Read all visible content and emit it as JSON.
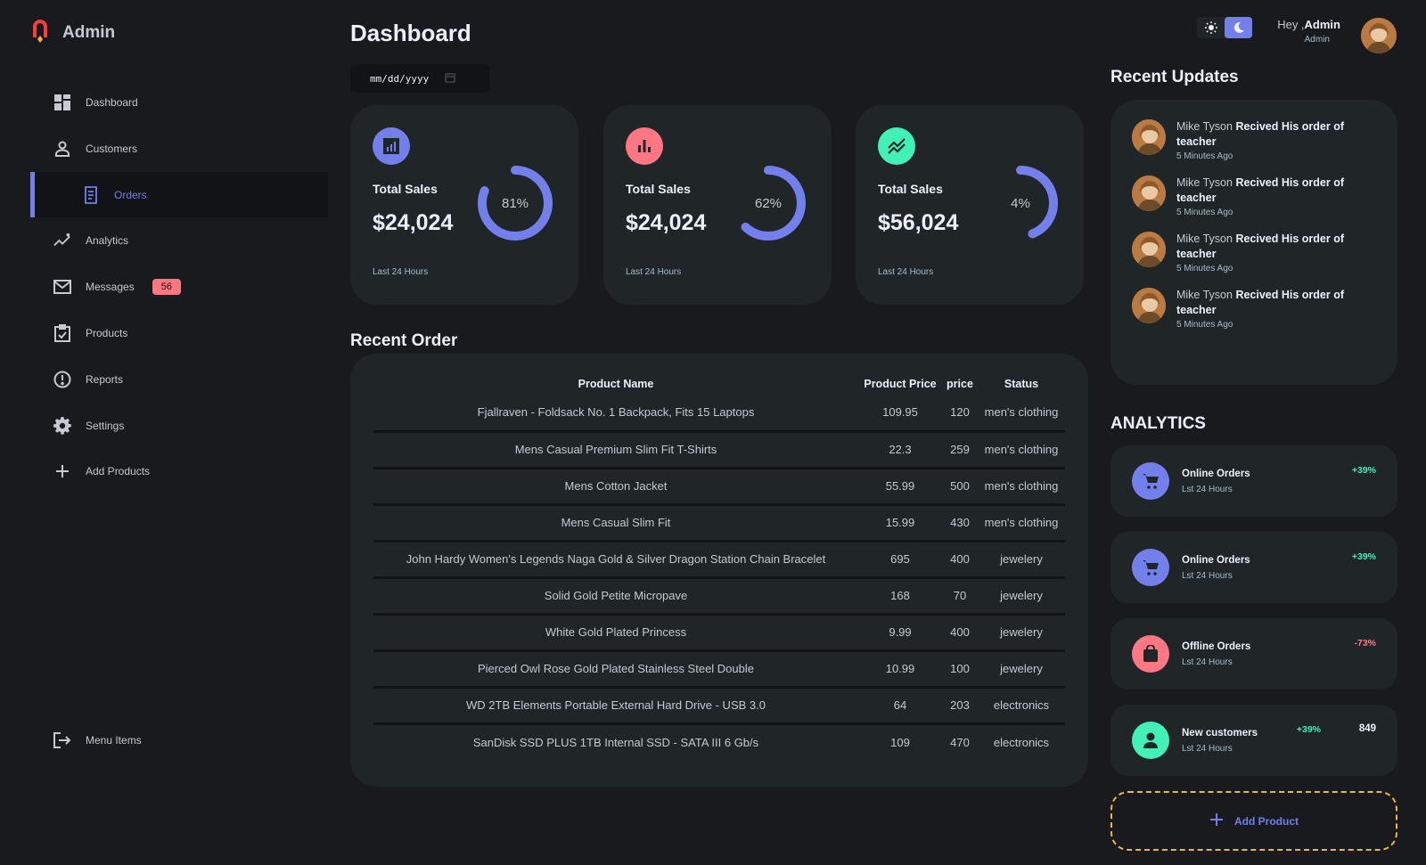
{
  "brand": {
    "title": "Admin"
  },
  "sidebar": {
    "items": [
      {
        "label": "Dashboard",
        "icon": "grid-icon"
      },
      {
        "label": "Customers",
        "icon": "person-icon"
      },
      {
        "label": "Orders",
        "icon": "receipt-icon",
        "active": true
      },
      {
        "label": "Analytics",
        "icon": "insights-icon"
      },
      {
        "label": "Messages",
        "icon": "mail-icon",
        "badge": "56"
      },
      {
        "label": "Products",
        "icon": "inventory-icon"
      },
      {
        "label": "Reports",
        "icon": "report-icon"
      },
      {
        "label": "Settings",
        "icon": "gear-icon"
      },
      {
        "label": "Add Products",
        "icon": "plus-icon"
      }
    ],
    "logout": {
      "label": "Menu Items",
      "icon": "logout-icon"
    }
  },
  "main": {
    "title": "Dashboard",
    "date_placeholder": "mm/dd/yyyy",
    "cards": [
      {
        "label": "Total Sales",
        "value": "$24,024",
        "percent": 81,
        "percent_label": "81%",
        "foot": "Last 24 Hours",
        "icon": "analytics-icon",
        "color": "#7380ec"
      },
      {
        "label": "Total Sales",
        "value": "$24,024",
        "percent": 62,
        "percent_label": "62%",
        "foot": "Last 24 Hours",
        "icon": "bar-chart-icon",
        "color": "#ff7782"
      },
      {
        "label": "Total Sales",
        "value": "$56,024",
        "percent": 44,
        "percent_label": "4%",
        "foot": "Last 24 Hours",
        "icon": "trending-icon",
        "color": "#41f1b6"
      }
    ],
    "recent_order_title": "Recent Order",
    "table": {
      "headers": [
        "Product Name",
        "Product Price",
        "price",
        "Status"
      ],
      "rows": [
        [
          "Fjallraven - Foldsack No. 1 Backpack, Fits 15 Laptops",
          "109.95",
          "120",
          "men's clothing"
        ],
        [
          "Mens Casual Premium Slim Fit T-Shirts",
          "22.3",
          "259",
          "men's clothing"
        ],
        [
          "Mens Cotton Jacket",
          "55.99",
          "500",
          "men's clothing"
        ],
        [
          "Mens Casual Slim Fit",
          "15.99",
          "430",
          "men's clothing"
        ],
        [
          "John Hardy Women's Legends Naga Gold & Silver Dragon Station Chain Bracelet",
          "695",
          "400",
          "jewelery"
        ],
        [
          "Solid Gold Petite Micropave",
          "168",
          "70",
          "jewelery"
        ],
        [
          "White Gold Plated Princess",
          "9.99",
          "400",
          "jewelery"
        ],
        [
          "Pierced Owl Rose Gold Plated Stainless Steel Double",
          "10.99",
          "100",
          "jewelery"
        ],
        [
          "WD 2TB Elements Portable External Hard Drive - USB 3.0",
          "64",
          "203",
          "electronics"
        ],
        [
          "SanDisk SSD PLUS 1TB Internal SSD - SATA III 6 Gb/s",
          "109",
          "470",
          "electronics"
        ]
      ]
    }
  },
  "header": {
    "greeting": "Hey ,",
    "user_name": "Admin",
    "user_role": "Admin"
  },
  "updates": {
    "title": "Recent Updates",
    "items": [
      {
        "name": "Mike Tyson",
        "action": "Recived His order of teacher",
        "time": "5 Minutes Ago"
      },
      {
        "name": "Mike Tyson",
        "action": "Recived His order of teacher",
        "time": "5 Minutes Ago"
      },
      {
        "name": "Mike Tyson",
        "action": "Recived His order of teacher",
        "time": "5 Minutes Ago"
      },
      {
        "name": "Mike Tyson",
        "action": "Recived His order of teacher",
        "time": "5 Minutes Ago"
      }
    ]
  },
  "analytics": {
    "title": "ANALYTICS",
    "items": [
      {
        "title": "Online Orders",
        "sub": "Lst 24 Hours",
        "pct": "+39%",
        "pct_color": "#41f1b6",
        "icon": "cart-icon",
        "icon_color": "#7380ec"
      },
      {
        "title": "Online Orders",
        "sub": "Lst 24 Hours",
        "pct": "+39%",
        "pct_color": "#41f1b6",
        "icon": "cart-icon",
        "icon_color": "#7380ec"
      },
      {
        "title": "Offline Orders",
        "sub": "Lst 24 Hours",
        "pct": "-73%",
        "pct_color": "#ff7782",
        "icon": "bag-icon",
        "icon_color": "#ff7782"
      },
      {
        "title": "New customers",
        "sub": "Lst 24 Hours",
        "pct": "+39%",
        "pct_color": "#41f1b6",
        "count": "849",
        "icon": "person-icon",
        "icon_color": "#41f1b6"
      }
    ],
    "add_product_label": "Add Product"
  },
  "colors": {
    "primary": "#7380ec",
    "danger": "#ff7782",
    "success": "#41f1b6",
    "warning": "#f2b348",
    "card": "#202528",
    "bg": "#181a1e"
  }
}
